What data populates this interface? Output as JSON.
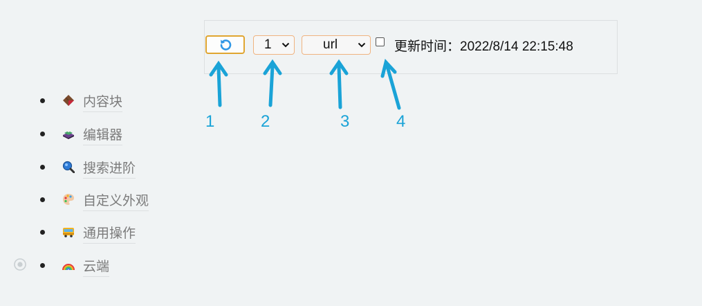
{
  "toolbar": {
    "page_select_value": "1",
    "mode_select_value": "url",
    "update_label": "更新时间：",
    "update_time": "2022/8/14 22:15:48"
  },
  "annotations": [
    "1",
    "2",
    "3",
    "4"
  ],
  "nav": {
    "items": [
      {
        "label": "内容块",
        "icon": "chocolate-bar-icon"
      },
      {
        "label": "编辑器",
        "icon": "stacked-books-icon"
      },
      {
        "label": "搜索进阶",
        "icon": "magnifier-icon"
      },
      {
        "label": "自定义外观",
        "icon": "palette-icon"
      },
      {
        "label": "通用操作",
        "icon": "bus-icon"
      },
      {
        "label": "云端",
        "icon": "rainbow-icon"
      }
    ]
  },
  "colors": {
    "accent_arrow": "#1aa3d7",
    "refresh_border": "#e0a530",
    "select_border": "#f0b37f",
    "background": "#f0f3f4"
  }
}
